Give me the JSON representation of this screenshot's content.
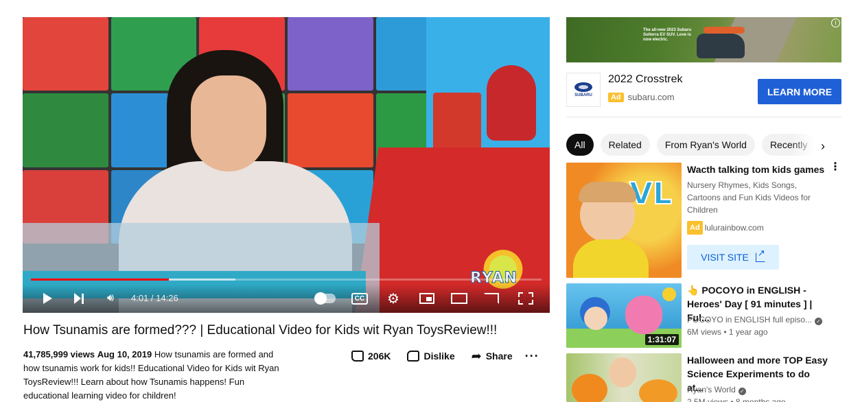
{
  "player": {
    "time": "4:01 / 14:26",
    "progress_played": 0.27,
    "progress_buffered": 0.4,
    "icons": [
      "play-icon",
      "next-icon",
      "volume-icon",
      "autoplay-toggle-icon",
      "captions-icon",
      "settings-icon",
      "miniplayer-icon",
      "theater-icon",
      "cast-icon",
      "fullscreen-icon"
    ],
    "cc_label": "CC",
    "watermark": "RYAN"
  },
  "video": {
    "title": "How Tsunamis are formed??? | Educational Video for Kids wit Ryan ToysReview!!!",
    "views": "41,785,999 views",
    "date": "Aug 10, 2019",
    "description": "How tsunamis are formed and how tsunamis work for kids!! Educational Video for Kids wit Ryan ToysReview!!! Learn about how Tsunamis happens! Fun educational learning video for children!",
    "likes": "206K",
    "dislike_label": "Dislike",
    "share_label": "Share",
    "more_label": "···"
  },
  "ad": {
    "banner_text": "The all-new 2023 Subaru Solterra EV SUV. Love is now electric.",
    "brand_logo_text": "SUBARU",
    "title": "2022 Crosstrek",
    "badge": "Ad",
    "domain": "subaru.com",
    "cta": "LEARN MORE"
  },
  "chips": [
    "All",
    "Related",
    "From Ryan's World",
    "Recently"
  ],
  "sidebar": {
    "items": [
      {
        "title": "Wacth talking tom kids games",
        "description": "Nursery Rhymes, Kids Songs, Cartoons and Fun Kids Videos for Children",
        "badge": "Ad",
        "domain": "lulurainbow.com",
        "cta": "VISIT SITE",
        "thumb_text": "VL"
      },
      {
        "title": "👆 POCOYO in ENGLISH - Heroes' Day [ 91 minutes ] | Ful...",
        "channel": "POCOYO in ENGLISH full episo...",
        "meta": "6M views • 1 year ago",
        "duration": "1:31:07"
      },
      {
        "title": "Halloween and more TOP Easy Science Experiments to do at...",
        "channel": "Ryan's World",
        "meta": "2.5M views • 8 months ago"
      }
    ]
  },
  "colors": {
    "accent_red": "#ff0000",
    "learn_more_blue": "#1f60d6",
    "visit_site_bg": "#def1ff",
    "ad_badge": "#fbc02d"
  }
}
